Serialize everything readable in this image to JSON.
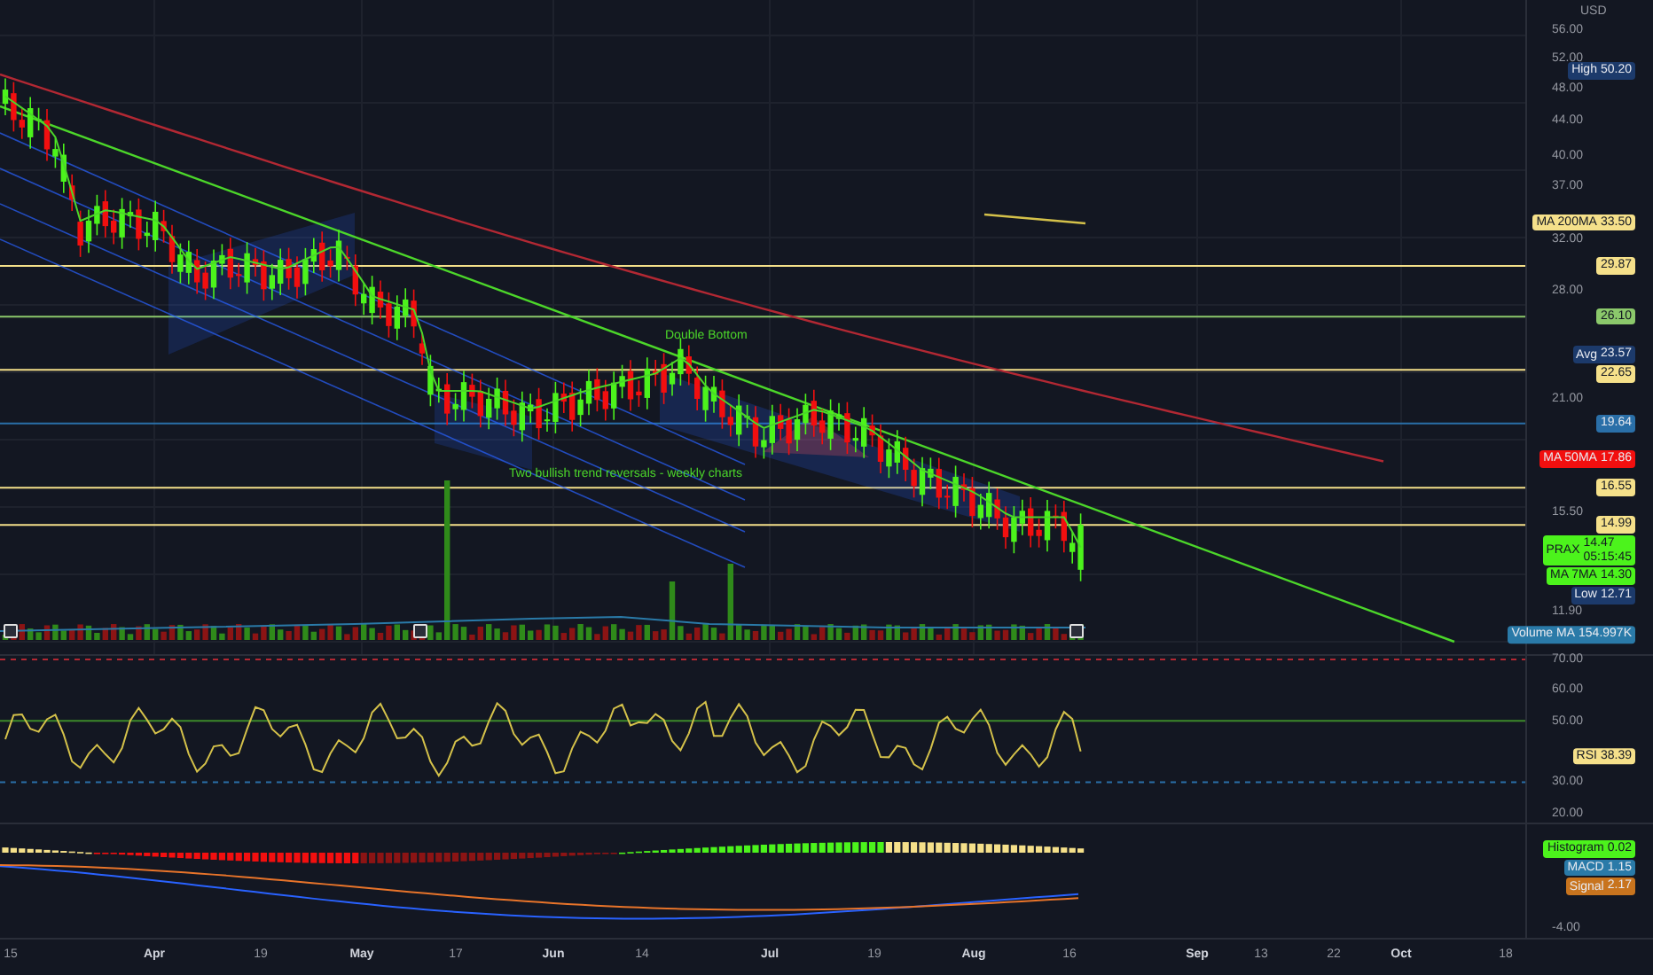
{
  "price_axis": {
    "unit": "USD",
    "ticks": [
      "56.00",
      "52.00",
      "48.00",
      "44.00",
      "40.00",
      "37.00",
      "32.00",
      "28.00",
      "21.00",
      "15.50",
      "11.90"
    ]
  },
  "price_tags": [
    {
      "label": "High",
      "value": "50.20",
      "kind": "stat",
      "color": "#1c3a6b"
    },
    {
      "label": "MA 200MA",
      "value": "33.50",
      "kind": "stat",
      "color": "#f5e08a"
    },
    {
      "value": "29.87",
      "kind": "level",
      "color": "#f5e08a"
    },
    {
      "value": "26.10",
      "kind": "level",
      "color": "#8bc86b"
    },
    {
      "label": "Avg",
      "value": "23.57",
      "kind": "stat",
      "color": "#1c3a6b"
    },
    {
      "value": "22.65",
      "kind": "level",
      "color": "#f5e08a"
    },
    {
      "value": "19.64",
      "kind": "level",
      "color": "#2a6fa8"
    },
    {
      "label": "MA 50MA",
      "value": "17.86",
      "kind": "stat",
      "color": "#f20f0f"
    },
    {
      "value": "16.55",
      "kind": "level",
      "color": "#f5e08a"
    },
    {
      "value": "14.99",
      "kind": "level",
      "color": "#f5e08a"
    },
    {
      "label": "PRAX",
      "value": "14.47",
      "extra": "05:15:45",
      "kind": "stat",
      "color": "#4cf31c"
    },
    {
      "label": "MA 7MA",
      "value": "14.30",
      "kind": "stat",
      "color": "#4cf31c"
    },
    {
      "label": "Low",
      "value": "12.71",
      "kind": "stat",
      "color": "#1c3a6b"
    }
  ],
  "volume_tag": {
    "label": "Volume MA",
    "value": "154.997K",
    "color": "#2a7aa8"
  },
  "annotations": [
    {
      "text": "Double Bottom"
    },
    {
      "text": "Two bullish trend reversals - weekly charts"
    }
  ],
  "rsi": {
    "ticks": [
      "70.00",
      "60.00",
      "50.00",
      "30.00",
      "20.00"
    ],
    "tag": {
      "label": "RSI",
      "value": "38.39",
      "color": "#f5e08a"
    }
  },
  "macd": {
    "tags": [
      {
        "label": "Histogram",
        "value": "0.02",
        "color": "#4cf31c"
      },
      {
        "label": "MACD",
        "value": "1.15",
        "color": "#2a7aa8"
      },
      {
        "label": "Signal",
        "value": "2.17",
        "color": "#c8741e"
      }
    ],
    "ticks": [
      "-4.00"
    ]
  },
  "time_axis": [
    {
      "label": "15",
      "kind": "day"
    },
    {
      "label": "Apr",
      "kind": "month"
    },
    {
      "label": "19",
      "kind": "day"
    },
    {
      "label": "May",
      "kind": "month"
    },
    {
      "label": "17",
      "kind": "day"
    },
    {
      "label": "Jun",
      "kind": "month"
    },
    {
      "label": "14",
      "kind": "day"
    },
    {
      "label": "Jul",
      "kind": "month"
    },
    {
      "label": "19",
      "kind": "day"
    },
    {
      "label": "Aug",
      "kind": "month"
    },
    {
      "label": "16",
      "kind": "day"
    },
    {
      "label": "Sep",
      "kind": "month"
    },
    {
      "label": "13",
      "kind": "day"
    },
    {
      "label": "22",
      "kind": "day"
    },
    {
      "label": "Oct",
      "kind": "month"
    },
    {
      "label": "18",
      "kind": "day"
    }
  ]
}
